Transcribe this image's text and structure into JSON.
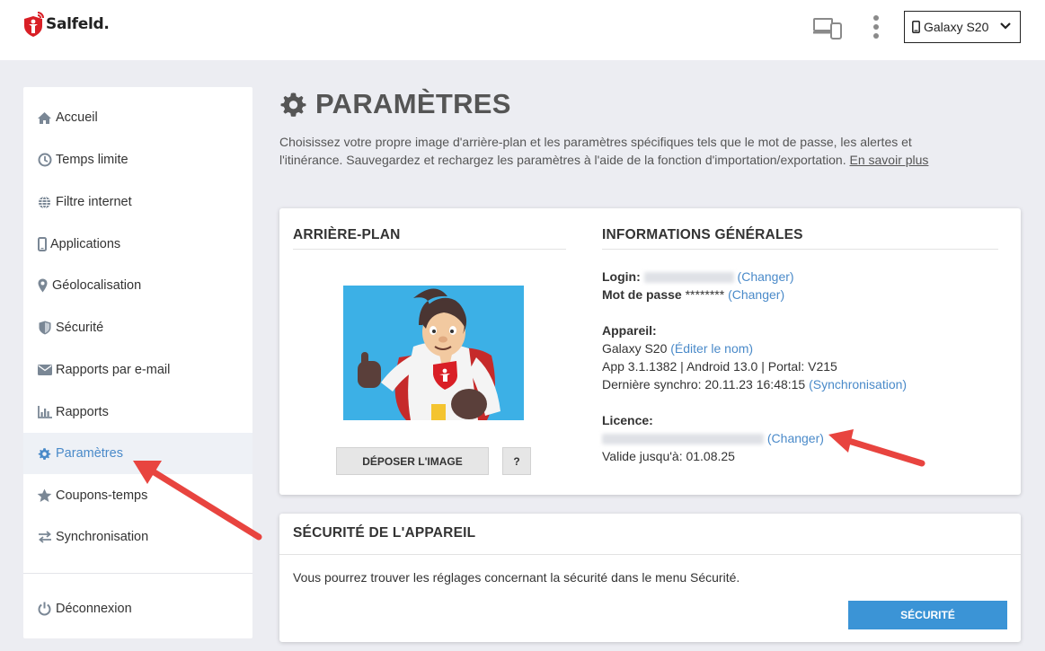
{
  "header": {
    "brand": "Salfeld.",
    "device_selector": {
      "value": "Galaxy S20"
    }
  },
  "sidebar": {
    "items": [
      {
        "label": "Accueil",
        "icon": "home-icon"
      },
      {
        "label": "Temps limite",
        "icon": "clock-icon"
      },
      {
        "label": "Filtre internet",
        "icon": "globe-icon"
      },
      {
        "label": "Applications",
        "icon": "phone-icon"
      },
      {
        "label": "Géolocalisation",
        "icon": "map-pin-icon"
      },
      {
        "label": "Sécurité",
        "icon": "shield-icon"
      },
      {
        "label": "Rapports par e-mail",
        "icon": "envelope-icon"
      },
      {
        "label": "Rapports",
        "icon": "bar-chart-icon"
      },
      {
        "label": "Paramètres",
        "icon": "gear-icon",
        "active": true
      },
      {
        "label": "Coupons-temps",
        "icon": "star-icon"
      },
      {
        "label": "Synchronisation",
        "icon": "sync-icon"
      }
    ],
    "logout": {
      "label": "Déconnexion",
      "icon": "power-icon"
    }
  },
  "page": {
    "title": "PARAMÈTRES",
    "description": "Choisissez votre propre image d'arrière-plan et les paramètres spécifiques tels que le mot de passe, les alertes et l'itinérance. Sauvegardez et rechargez les paramètres à l'aide de la fonction d'importation/exportation.",
    "learn_more": "En savoir plus"
  },
  "background_card": {
    "title": "ARRIÈRE-PLAN",
    "upload_button": "DÉPOSER L'IMAGE",
    "help_button": "?"
  },
  "info_card": {
    "title": "INFORMATIONS GÉNÉRALES",
    "login_label": "Login:",
    "login_change": "(Changer)",
    "password_label": "Mot de passe",
    "password_value": "********",
    "password_change": "(Changer)",
    "device_label": "Appareil:",
    "device_name": "Galaxy S20",
    "device_rename": "(Éditer le nom)",
    "device_versions": "App 3.1.1382 | Android 13.0 | Portal: V215",
    "last_sync_label": "Dernière synchro: 20.11.23 16:48:15",
    "sync_link": "(Synchronisation)",
    "license_label": "Licence:",
    "license_change": "(Changer)",
    "valid_until": "Valide jusqu'à: 01.08.25"
  },
  "security_card": {
    "title": "SÉCURITÉ DE L'APPAREIL",
    "text": "Vous pourrez trouver les réglages concernant la sécurité dans le menu Sécurité.",
    "button": "SÉCURITÉ"
  },
  "colors": {
    "accent": "#3b94d6",
    "link": "#4a8ac9",
    "annotation_arrow": "#e8443f",
    "background": "#ecedf2"
  }
}
